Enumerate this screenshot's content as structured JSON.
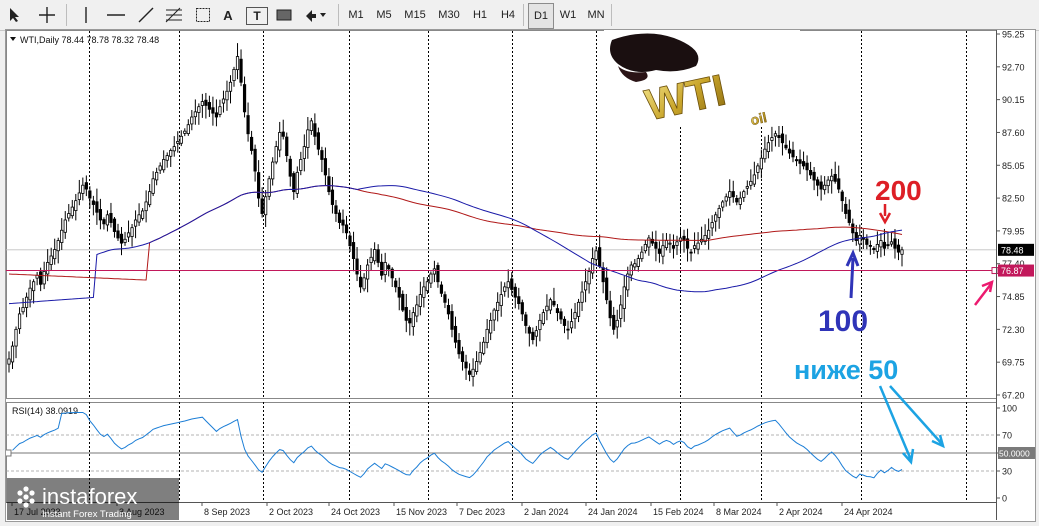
{
  "toolbar": {
    "timeframes": [
      "M1",
      "M5",
      "M15",
      "M30",
      "H1",
      "H4",
      "D1",
      "W1",
      "MN"
    ],
    "active_timeframe": "D1",
    "tools": [
      "cursor-arrow",
      "crosshair",
      "vertical-line",
      "horizontal-line",
      "trend-line",
      "fibonacci",
      "text",
      "text-label",
      "rectangle",
      "arrows"
    ],
    "text_tool_label": "A",
    "label_tool_label": "T"
  },
  "chart_data": [
    {
      "type": "candlestick",
      "header": "WTI,Daily  78.44 78.78 78.32 78.48",
      "symbol": "WTI",
      "timeframe": "Daily",
      "ohlc_last": {
        "open": 78.44,
        "high": 78.78,
        "low": 78.32,
        "close": 78.48
      },
      "price_axis_ticks": [
        "95.25",
        "92.70",
        "90.15",
        "87.60",
        "85.05",
        "82.50",
        "79.95",
        "77.40",
        "74.85",
        "72.30",
        "69.75",
        "67.20"
      ],
      "ylim": [
        67.2,
        95.25
      ],
      "time_axis_labels": [
        "17 Jul 2023",
        "8 Aug 2023",
        "8 Sep 2023",
        "2 Oct 2023",
        "24 Oct 2023",
        "15 Nov 2023",
        "7 Dec 2023",
        "2 Jan 2024",
        "24 Jan 2024",
        "15 Feb 2024",
        "8 Mar 2024",
        "2 Apr 2024",
        "24 Apr 2024"
      ],
      "period_separators": "dotted vertical lines at month starts",
      "current_price_label": "78.48",
      "horizontal_level_label": "76.87",
      "horizontal_level": 76.87,
      "closes_approx": [
        70.0,
        71.0,
        72.3,
        73.5,
        74.0,
        74.8,
        75.5,
        76.0,
        76.5,
        75.8,
        76.8,
        77.5,
        78.0,
        78.5,
        79.2,
        80.0,
        80.8,
        81.3,
        81.8,
        82.3,
        82.9,
        83.5,
        83.2,
        82.5,
        82.0,
        81.4,
        80.8,
        80.5,
        81.2,
        80.6,
        79.9,
        79.4,
        79.0,
        79.3,
        79.8,
        80.2,
        80.8,
        81.2,
        81.5,
        82.2,
        83.0,
        84.0,
        84.5,
        85.0,
        85.5,
        85.8,
        86.2,
        86.5,
        86.9,
        87.3,
        87.7,
        88.2,
        88.8,
        89.2,
        89.6,
        90.0,
        89.7,
        89.4,
        89.1,
        88.8,
        89.6,
        90.2,
        90.8,
        91.5,
        92.5,
        93.5,
        91.5,
        89.2,
        87.5,
        86.2,
        84.6,
        82.5,
        81.3,
        82.6,
        84.0,
        85.3,
        86.5,
        87.6,
        87.3,
        85.8,
        84.2,
        83.0,
        84.5,
        85.5,
        86.5,
        87.8,
        88.5,
        87.3,
        86.3,
        85.5,
        84.3,
        83.0,
        82.0,
        81.3,
        80.6,
        80.4,
        79.8,
        78.8,
        77.8,
        76.6,
        75.6,
        76.3,
        77.3,
        77.9,
        78.5,
        77.5,
        76.5,
        77.5,
        77.0,
        76.3,
        75.6,
        74.8,
        73.8,
        73.0,
        72.8,
        73.6,
        74.2,
        75.0,
        75.6,
        76.0,
        76.6,
        77.0,
        76.0,
        75.1,
        74.4,
        73.5,
        72.3,
        71.3,
        70.4,
        69.8,
        69.3,
        68.8,
        69.2,
        69.8,
        70.5,
        71.3,
        72.3,
        73.0,
        73.8,
        74.4,
        75.0,
        75.6,
        76.0,
        75.4,
        74.8,
        74.3,
        73.5,
        72.6,
        72.0,
        71.5,
        72.2,
        73.0,
        73.6,
        74.1,
        74.6,
        74.2,
        73.6,
        73.1,
        72.6,
        72.3,
        72.9,
        73.6,
        74.4,
        75.2,
        76.0,
        76.8,
        77.8,
        78.4,
        77.2,
        76.0,
        74.6,
        73.2,
        72.3,
        73.0,
        74.2,
        75.6,
        76.6,
        77.3,
        77.4,
        77.8,
        78.3,
        78.9,
        79.4,
        79.0,
        78.6,
        78.2,
        78.8,
        79.2,
        79.0,
        78.6,
        79.1,
        79.4,
        79.2,
        78.6,
        78.3,
        78.8,
        79.0,
        79.3,
        79.6,
        80.0,
        80.6,
        81.2,
        81.7,
        82.2,
        82.6,
        83.0,
        82.6,
        82.2,
        82.5,
        83.0,
        83.4,
        83.8,
        84.3,
        85.0,
        85.6,
        86.3,
        86.8,
        87.2,
        87.5,
        87.2,
        86.8,
        86.4,
        86.0,
        85.7,
        85.4,
        85.2,
        85.0,
        84.7,
        84.3,
        83.9,
        83.5,
        83.2,
        83.5,
        83.9,
        84.2,
        83.8,
        83.2,
        82.3,
        81.3,
        80.6,
        79.8,
        79.2,
        79.6,
        79.3,
        78.9,
        78.8,
        78.5,
        78.9,
        79.2,
        78.6,
        78.8,
        79.1,
        78.6,
        78.3,
        78.48
      ],
      "indicators": [
        {
          "name": "100",
          "kind": "moving average",
          "color": "#1a1aa8"
        },
        {
          "name": "200",
          "kind": "moving average",
          "color": "#b01818"
        }
      ]
    },
    {
      "type": "line",
      "header": "RSI(14) 38.0919",
      "indicator": "RSI(14)",
      "value_label": "50.0000",
      "ticks": [
        "100",
        "70",
        "50",
        "30",
        "0"
      ],
      "ylim": [
        0,
        100
      ],
      "levels": [
        70,
        50,
        30
      ],
      "series_color": "#1c7ed6"
    }
  ],
  "annotations": {
    "ma_200_label": "200",
    "ma_100_label": "100",
    "rsi_note": "ниже 50"
  },
  "colors": {
    "ma100": "#1a1aa8",
    "ma200": "#b01818",
    "level_line": "#c2185b",
    "annotation_red": "#dd1f26",
    "annotation_blue": "#2f34b8",
    "annotation_cyan": "#1ca3e3",
    "annotation_pink": "#ec1a6f"
  },
  "watermark": {
    "brand": "instaforex",
    "tagline": "Instant Forex Trading"
  },
  "logo_image": {
    "text": "WTI",
    "subtext": "oil"
  }
}
